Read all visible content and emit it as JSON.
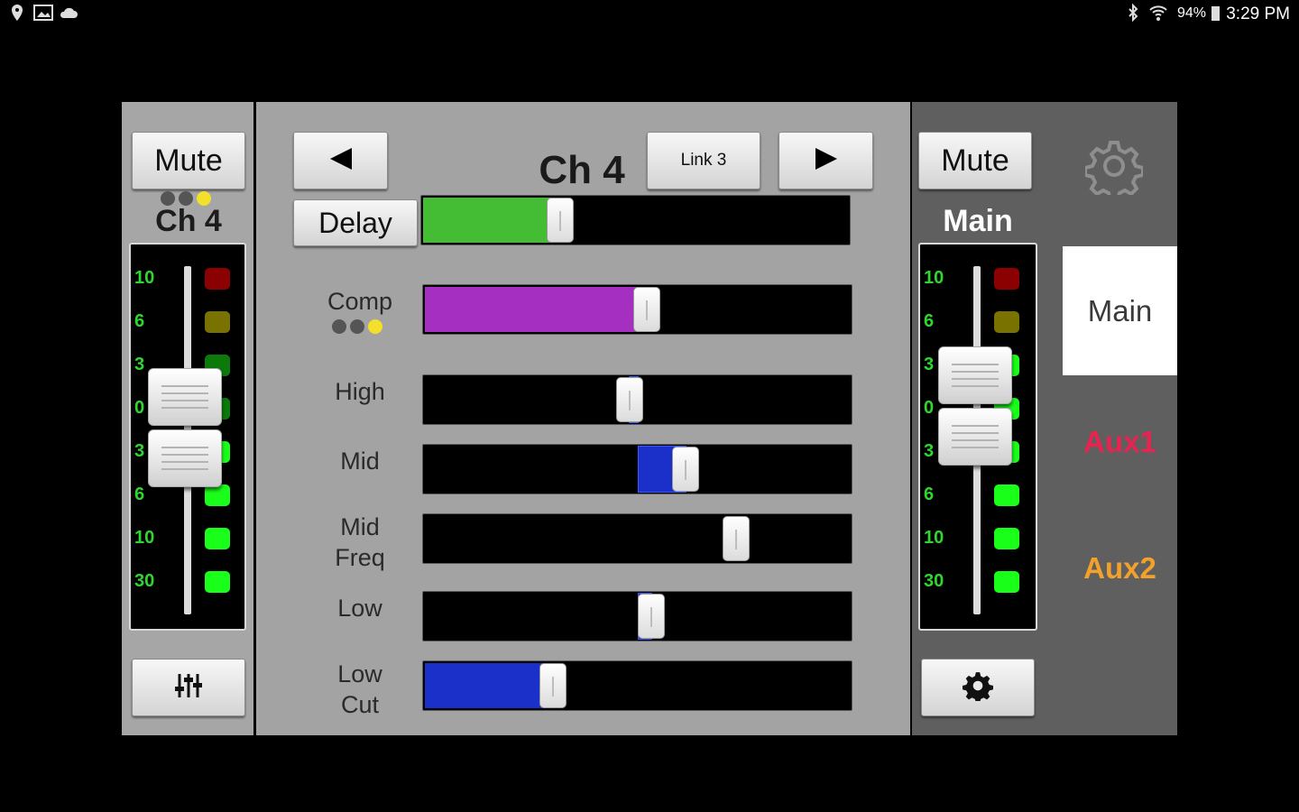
{
  "status_bar": {
    "left_icons": [
      "location-icon",
      "image-icon",
      "cloud-icon"
    ],
    "battery": "94%",
    "time": "3:29 PM"
  },
  "left_strip": {
    "mute_label": "Mute",
    "channel_name": "Ch 4",
    "dots_colors": [
      "#555555",
      "#555555",
      "#f2e02a"
    ],
    "meter_scale": [
      "10",
      "6",
      "3",
      "0",
      "3",
      "6",
      "10",
      "30"
    ],
    "led_colors": [
      "#8b0000",
      "#7a7200",
      "#0b7a0b",
      "#0b7a0b",
      "#1aff1a",
      "#1aff1a",
      "#1aff1a",
      "#1aff1a"
    ],
    "fader_level_db": 0,
    "eq_icon": "equalizer-icon"
  },
  "center": {
    "prev_icon": "triangle-left-icon",
    "next_icon": "triangle-right-icon",
    "channel_title": "Ch 4",
    "link_label": "Link 3",
    "delay_label": "Delay",
    "params": [
      {
        "label": "Comp",
        "value": 0.52,
        "color": "#a52fc0",
        "mode": "fill"
      },
      {
        "label": "High",
        "value": 0.48,
        "color": "#1a30c8",
        "mode": "bipolar"
      },
      {
        "label": "Mid",
        "value": 0.61,
        "color": "#1a30c8",
        "mode": "bipolar"
      },
      {
        "label": "Mid\nFreq",
        "value": 0.73,
        "color": "#1a30c8",
        "mode": "none"
      },
      {
        "label": "Low",
        "value": 0.53,
        "color": "#1a30c8",
        "mode": "bipolar"
      },
      {
        "label": "Low\nCut",
        "value": 0.3,
        "color": "#1a30c8",
        "mode": "fill"
      }
    ],
    "delay_value": 0.32,
    "delay_color": "#44bd34",
    "comp_dots_colors": [
      "#555555",
      "#555555",
      "#f2e02a"
    ]
  },
  "right_strip": {
    "mute_label": "Mute",
    "bus_name": "Main",
    "gear_icon": "gear-icon",
    "settings_icon": "gear-icon",
    "meter_scale": [
      "10",
      "6",
      "3",
      "0",
      "3",
      "6",
      "10",
      "30"
    ],
    "led_colors": [
      "#8b0000",
      "#7a7200",
      "#1aff1a",
      "#1aff1a",
      "#1aff1a",
      "#1aff1a",
      "#1aff1a",
      "#1aff1a"
    ],
    "tabs": [
      {
        "label": "Main",
        "color": "#3a3a3a",
        "selected": true
      },
      {
        "label": "Aux1",
        "color": "#e8234f",
        "selected": false
      },
      {
        "label": "Aux2",
        "color": "#f2a12b",
        "selected": false
      }
    ]
  }
}
